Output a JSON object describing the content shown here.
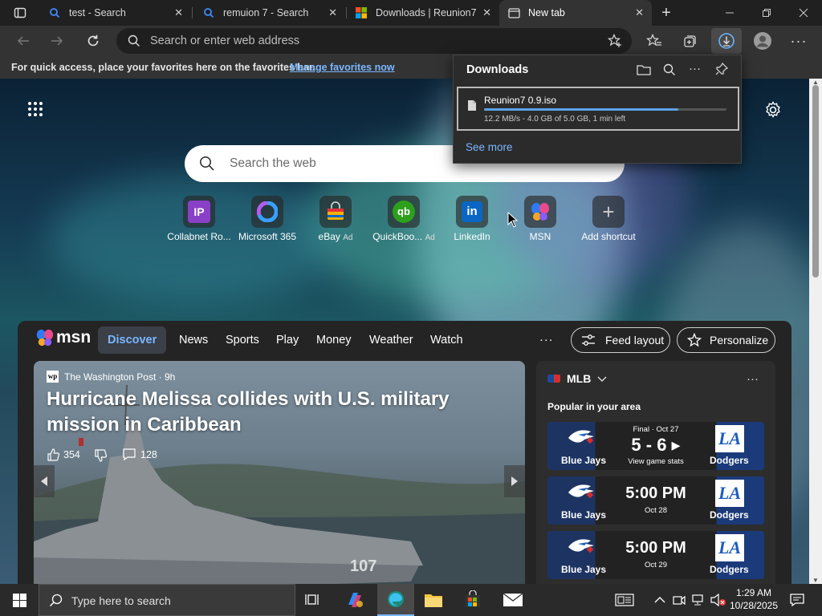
{
  "tabs": [
    {
      "label": "test - Search",
      "icon": "bing-search-icon"
    },
    {
      "label": "remuion 7 - Search",
      "icon": "bing-search-icon"
    },
    {
      "label": "Downloads | Reunion7",
      "icon": "windows-logo-icon"
    },
    {
      "label": "New tab",
      "icon": "new-tab-icon",
      "active": true
    }
  ],
  "address_bar": {
    "placeholder": "Search or enter web address"
  },
  "favorites_bar": {
    "text": "For quick access, place your favorites here on the favorites bar.",
    "link": "Manage favorites now"
  },
  "downloads": {
    "title": "Downloads",
    "item": {
      "name": "Reunion7 0.9.iso",
      "status": "12.2 MB/s - 4.0 GB of 5.0 GB, 1 min left",
      "progress": 0.8
    },
    "see_more": "See more"
  },
  "newtab": {
    "search_placeholder": "Search the web",
    "shortcuts": [
      {
        "label": "Collabnet Ro...",
        "ad": ""
      },
      {
        "label": "Microsoft 365",
        "ad": ""
      },
      {
        "label": "eBay",
        "ad": "Ad"
      },
      {
        "label": "QuickBoo...",
        "ad": "Ad"
      },
      {
        "label": "LinkedIn",
        "ad": ""
      },
      {
        "label": "MSN",
        "ad": ""
      },
      {
        "label": "Add shortcut",
        "ad": ""
      }
    ]
  },
  "msn": {
    "logo": "msn",
    "nav": [
      "Discover",
      "News",
      "Sports",
      "Play",
      "Money",
      "Weather",
      "Watch"
    ],
    "more": "···",
    "feed_layout": "Feed layout",
    "personalize": "Personalize",
    "hero": {
      "source": "The Washington Post · 9h",
      "headline": "Hurricane Melissa collides with U.S. military mission in Caribbean",
      "likes": "354",
      "comments": "128",
      "hull_number": "107"
    },
    "sports": {
      "league": "MLB",
      "subtitle": "Popular in your area",
      "games": [
        {
          "home": "Blue Jays",
          "away": "Dodgers",
          "top": "Final · Oct 27",
          "main": "5 - 6 ▸",
          "bottom": "View game stats"
        },
        {
          "home": "Blue Jays",
          "away": "Dodgers",
          "top": "",
          "main": "5:00 PM",
          "bottom": "Oct 28"
        },
        {
          "home": "Blue Jays",
          "away": "Dodgers",
          "top": "",
          "main": "5:00 PM",
          "bottom": "Oct 29"
        }
      ]
    }
  },
  "taskbar": {
    "search_placeholder": "Type here to search",
    "time": "1:29 AM",
    "date": "10/28/2025"
  }
}
